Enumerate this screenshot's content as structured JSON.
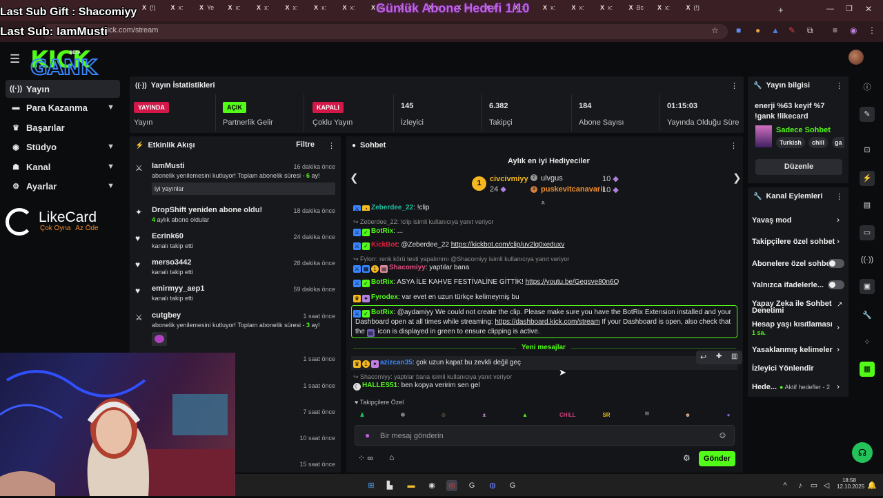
{
  "overlay": {
    "last_sub_gift": "Last Sub Gift : Shacomiyy",
    "last_sub": "Last Sub: IamMusti",
    "goal": "Günlük Abone Hedefi 1/10"
  },
  "browser": {
    "url": "kick.com/stream",
    "tabs": [
      "(!)",
      "x:",
      "Ye",
      "x:",
      "x:",
      "x:",
      "x:",
      "x:",
      "x:",
      "x:",
      "x:",
      "x:",
      "x:",
      "x:",
      "x:",
      "x:",
      "x:",
      "Bc",
      "x:",
      "(!)"
    ]
  },
  "sidebar": {
    "items": [
      {
        "label": "Yayın",
        "icon": "broadcast-icon",
        "expandable": false
      },
      {
        "label": "Para Kazanma",
        "icon": "money-icon",
        "expandable": true
      },
      {
        "label": "Başarılar",
        "icon": "trophy-icon",
        "expandable": false
      },
      {
        "label": "Stüdyo",
        "icon": "studio-icon",
        "expandable": true
      },
      {
        "label": "Kanal",
        "icon": "channel-icon",
        "expandable": true
      },
      {
        "label": "Ayarlar",
        "icon": "settings-icon",
        "expandable": true
      }
    ],
    "likecard": {
      "title": "LikeCard",
      "tagline_a": "Çok Oyna",
      "tagline_b": "Az Öde"
    }
  },
  "stats": {
    "title": "Yayın İstatistikleri",
    "cells": [
      {
        "value": "YAYINDA",
        "label": "Yayın",
        "badge": true,
        "color": "#d11848"
      },
      {
        "value": "AÇIK",
        "label": "Partnerlik Gelir",
        "badge": true,
        "color": "#53fc18"
      },
      {
        "value": "KAPALI",
        "label": "Çoklu Yayın",
        "badge": true,
        "color": "#d11848"
      },
      {
        "value": "145",
        "label": "İzleyici",
        "badge": false
      },
      {
        "value": "6.382",
        "label": "Takipçi",
        "badge": false
      },
      {
        "value": "184",
        "label": "Abone Sayısı",
        "badge": false
      },
      {
        "value": "01:15:03",
        "label": "Yayında Olduğu Süre",
        "badge": false
      }
    ]
  },
  "activity": {
    "title": "Etkinlik Akışı",
    "filter": "Filtre",
    "events": [
      {
        "icon": "resub-icon",
        "name": "IamMusti",
        "time": "16 dakika önce",
        "sub_a": "abonelik yenilemesini kutluyor! Toplam abonelik süresi - ",
        "sub_num": "6",
        "sub_b": " ay!",
        "msg": "iyi yayınlar"
      },
      {
        "icon": "sparkle-icon",
        "name": "DropShift yeniden abone oldu!",
        "time": "18 dakika önce",
        "sub_num": "4",
        "sub_b": " aylık abone oldular"
      },
      {
        "icon": "heart-icon",
        "name": "Ecrink60",
        "time": "24 dakika önce",
        "sub_b": "kanalı takip etti"
      },
      {
        "icon": "heart-icon",
        "name": "merso3442",
        "time": "28 dakika önce",
        "sub_b": "kanalı takip etti"
      },
      {
        "icon": "heart-icon",
        "name": "emirmyy_aep1",
        "time": "59 dakika önce",
        "sub_b": "kanalı takip etti"
      },
      {
        "icon": "resub-icon",
        "name": "cutgbey",
        "time": "1 saat önce",
        "sub_a": "abonelik yenilemesini kutluyor! Toplam abonelik süresi - ",
        "sub_num": "3",
        "sub_b": " ay!"
      }
    ],
    "more_times": [
      "1 saat önce",
      "1 saat önce",
      "7 saat önce",
      "10 saat önce",
      "15 saat önce"
    ]
  },
  "chat": {
    "title": "Sohbet",
    "gifters_title": "Aylık en iyi Hediyeciler",
    "gifters": [
      {
        "rank": "1",
        "name": "civcivmiyy",
        "count": "24"
      },
      {
        "rank": "2",
        "name": "ulvgus",
        "count": "10"
      },
      {
        "rank": "3",
        "name": "puskevitcanavarii",
        "count": "10"
      }
    ],
    "lines": {
      "l0_name": "Zeberdee_22",
      "l0_text": ": !clip",
      "l1_reply": "Zeberdee_22: !clip isimli kullanıcıya yanıt veriyor",
      "l1_name": "BotRix",
      "l1_text": ": ...",
      "l2_name": "KickBot",
      "l2_text": ": @Zeberdee_22 ",
      "l2_link": "https://kickbot.com/clip/uv2lq0xeduxv",
      "l3_reply": "Fylorr: renk körü testi yapalımmı @Shacomiyy isimli kullanıcıya yanıt veriyor",
      "l3_name": "Shacomiyy",
      "l3_text": ": yaptılar bana",
      "l4_name": "BotRix",
      "l4_text": ": ASYA İLE KAHVE FESTİVALİNE GİTTİK! ",
      "l4_link": "https://youtu.be/Gegsve80n6Q",
      "l5_name": "Fyrodex",
      "l5_text": ": var evet en uzun türkçe kelimeymiş bu",
      "l6_name": "BotRix",
      "l6_text_a": ": @aydamiyy We could not create the clip. Please make sure you have the BotRix Extension installed and your",
      "l6_text_b": "Dashboard open at all times while streaming: ",
      "l6_link": "https://dashboard.kick.com/stream",
      "l6_text_c": " If your Dashboard is open, also check that",
      "l6_text_d": "the ",
      "l6_text_e": " icon is displayed in green to ensure clipping is active.",
      "new_messages": "Yeni mesajlar",
      "l7_name": "azizcan35",
      "l7_text": ": çok uzun kapat bu zevkli değil geç",
      "l8_reply": "Shacomiyy: yaptılar bana isimli kullanıcıya yanıt veriyor",
      "l8_name": "HALLES51",
      "l8_text": ": ben kopya veririm sen gel"
    },
    "follower_label": "Takipçilere Özel",
    "emotes": [
      {
        "name": "among-us-emote",
        "color": "#20c060",
        "glyph": "♟"
      },
      {
        "name": "spider-emote",
        "color": "#888888",
        "glyph": "✱"
      },
      {
        "name": "face-emote",
        "color": "#c0a080",
        "glyph": "☺"
      },
      {
        "name": "cat-emote",
        "color": "#c080d0",
        "glyph": "ᴥ"
      },
      {
        "name": "kick-emote",
        "color": "#53fc18",
        "glyph": "▲"
      },
      {
        "name": "chill-emote",
        "color": "#d04080",
        "glyph": "CHILL"
      },
      {
        "name": "sr-emote",
        "color": "#e0c020",
        "glyph": "SR"
      },
      {
        "name": "hat-emote",
        "color": "#606060",
        "glyph": "▀"
      },
      {
        "name": "girl-emote",
        "color": "#e0b090",
        "glyph": "☻"
      },
      {
        "name": "ghost-emote",
        "color": "#9060e0",
        "glyph": "●"
      }
    ],
    "input_placeholder": "Bir mesaj gönderin",
    "send": "Gönder"
  },
  "stream_info": {
    "title": "Yayın bilgisi",
    "stream_title_a": "enerji %63 keyif %7",
    "stream_title_b": "!gank !likecard",
    "category": "Sadece Sohbet",
    "tags": [
      "Turkish",
      "chill",
      "ga"
    ],
    "edit": "Düzenle"
  },
  "channel_actions": {
    "title": "Kanal Eylemleri",
    "items": [
      {
        "label": "Yavaş mod",
        "type": "chevron"
      },
      {
        "label": "Takipçilere özel sohbet",
        "type": "chevron"
      },
      {
        "label": "Abonelere özel sohbet",
        "type": "toggle"
      },
      {
        "label": "Yalnızca ifadelerle...",
        "type": "toggle"
      },
      {
        "label": "Yapay Zeka ile Sohbet",
        "label_b": "Denetimi",
        "type": "external"
      },
      {
        "label": "Hesap yaşı kısıtlaması",
        "label_b": "1 sa.",
        "type": "chevron"
      },
      {
        "label": "Yasaklanmış kelimeler",
        "type": "chevron"
      },
      {
        "label": "İzleyici Yönlendir",
        "type": "none"
      },
      {
        "label": "Hede...",
        "extra": "Aktif hedefler - 2",
        "type": "chevron"
      }
    ]
  },
  "taskbar": {
    "time": "18:58",
    "date": "12.10.2025"
  },
  "colors": {
    "kick_green": "#53fc18",
    "live_red": "#d11848",
    "panel": "#17181c"
  }
}
